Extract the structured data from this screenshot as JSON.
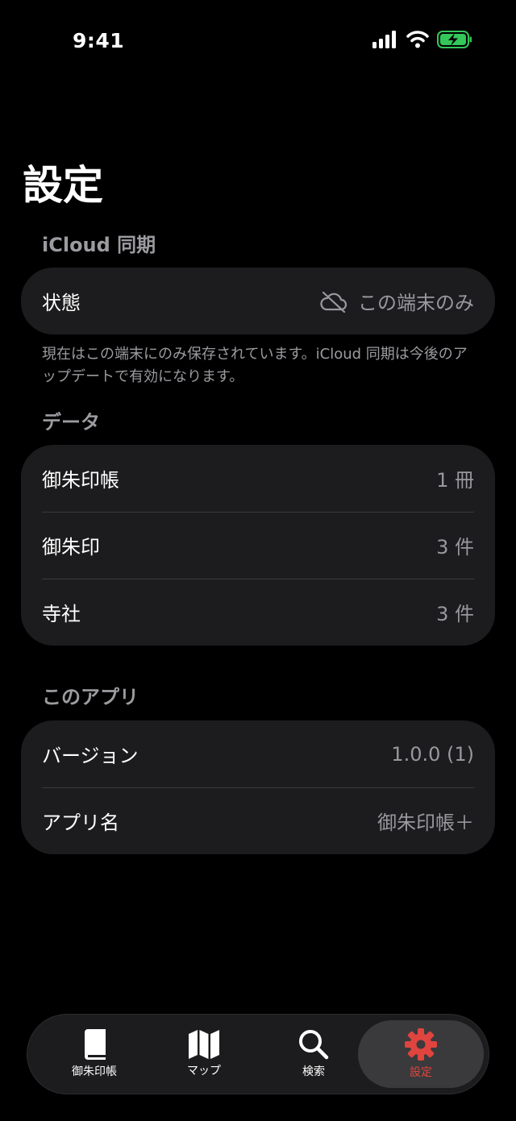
{
  "status_bar": {
    "time": "9:41"
  },
  "title": "設定",
  "icloud": {
    "header": "iCloud 同期",
    "status_label": "状態",
    "status_value": "この端末のみ",
    "status_icon": "cloud-slash-icon",
    "footnote": "現在はこの端末にのみ保存されています。iCloud 同期は今後のアップデートで有効になります。"
  },
  "data_section": {
    "header": "データ",
    "rows": [
      {
        "label": "御朱印帳",
        "value": "1 冊"
      },
      {
        "label": "御朱印",
        "value": "3 件"
      },
      {
        "label": "寺社",
        "value": "3 件"
      }
    ]
  },
  "app_section": {
    "header": "このアプリ",
    "rows": [
      {
        "label": "バージョン",
        "value": "1.0.0 (1)"
      },
      {
        "label": "アプリ名",
        "value": "御朱印帳＋"
      }
    ]
  },
  "tab_bar": {
    "tabs": [
      {
        "label": "御朱印帳",
        "icon": "book-icon"
      },
      {
        "label": "マップ",
        "icon": "map-icon"
      },
      {
        "label": "検索",
        "icon": "search-icon"
      },
      {
        "label": "設定",
        "icon": "gear-icon"
      }
    ],
    "active_index": 3
  },
  "colors": {
    "accent": "#e0443e",
    "battery": "#34c759",
    "background": "#000000",
    "card": "#1c1c1e"
  }
}
